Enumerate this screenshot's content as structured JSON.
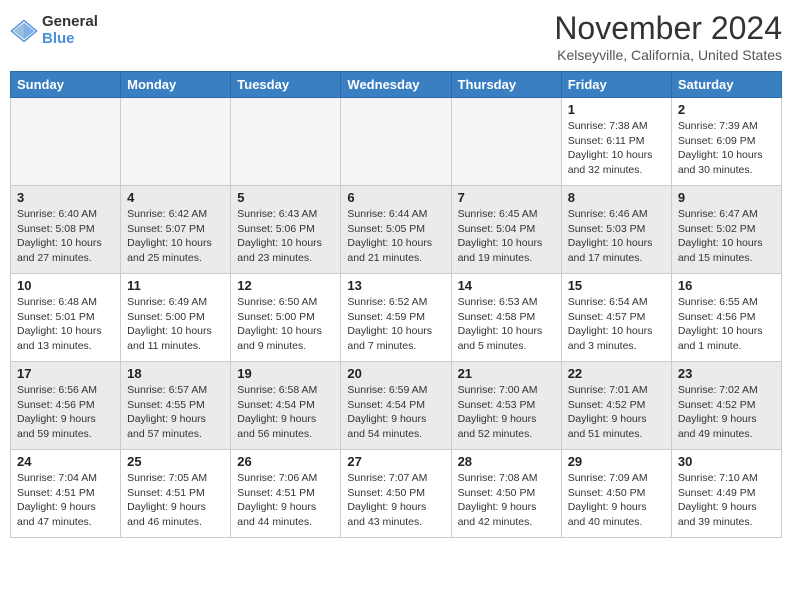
{
  "logo": {
    "general": "General",
    "blue": "Blue"
  },
  "title": "November 2024",
  "location": "Kelseyville, California, United States",
  "weekdays": [
    "Sunday",
    "Monday",
    "Tuesday",
    "Wednesday",
    "Thursday",
    "Friday",
    "Saturday"
  ],
  "weeks": [
    [
      {
        "day": "",
        "info": ""
      },
      {
        "day": "",
        "info": ""
      },
      {
        "day": "",
        "info": ""
      },
      {
        "day": "",
        "info": ""
      },
      {
        "day": "",
        "info": ""
      },
      {
        "day": "1",
        "info": "Sunrise: 7:38 AM\nSunset: 6:11 PM\nDaylight: 10 hours and 32 minutes."
      },
      {
        "day": "2",
        "info": "Sunrise: 7:39 AM\nSunset: 6:09 PM\nDaylight: 10 hours and 30 minutes."
      }
    ],
    [
      {
        "day": "3",
        "info": "Sunrise: 6:40 AM\nSunset: 5:08 PM\nDaylight: 10 hours and 27 minutes."
      },
      {
        "day": "4",
        "info": "Sunrise: 6:42 AM\nSunset: 5:07 PM\nDaylight: 10 hours and 25 minutes."
      },
      {
        "day": "5",
        "info": "Sunrise: 6:43 AM\nSunset: 5:06 PM\nDaylight: 10 hours and 23 minutes."
      },
      {
        "day": "6",
        "info": "Sunrise: 6:44 AM\nSunset: 5:05 PM\nDaylight: 10 hours and 21 minutes."
      },
      {
        "day": "7",
        "info": "Sunrise: 6:45 AM\nSunset: 5:04 PM\nDaylight: 10 hours and 19 minutes."
      },
      {
        "day": "8",
        "info": "Sunrise: 6:46 AM\nSunset: 5:03 PM\nDaylight: 10 hours and 17 minutes."
      },
      {
        "day": "9",
        "info": "Sunrise: 6:47 AM\nSunset: 5:02 PM\nDaylight: 10 hours and 15 minutes."
      }
    ],
    [
      {
        "day": "10",
        "info": "Sunrise: 6:48 AM\nSunset: 5:01 PM\nDaylight: 10 hours and 13 minutes."
      },
      {
        "day": "11",
        "info": "Sunrise: 6:49 AM\nSunset: 5:00 PM\nDaylight: 10 hours and 11 minutes."
      },
      {
        "day": "12",
        "info": "Sunrise: 6:50 AM\nSunset: 5:00 PM\nDaylight: 10 hours and 9 minutes."
      },
      {
        "day": "13",
        "info": "Sunrise: 6:52 AM\nSunset: 4:59 PM\nDaylight: 10 hours and 7 minutes."
      },
      {
        "day": "14",
        "info": "Sunrise: 6:53 AM\nSunset: 4:58 PM\nDaylight: 10 hours and 5 minutes."
      },
      {
        "day": "15",
        "info": "Sunrise: 6:54 AM\nSunset: 4:57 PM\nDaylight: 10 hours and 3 minutes."
      },
      {
        "day": "16",
        "info": "Sunrise: 6:55 AM\nSunset: 4:56 PM\nDaylight: 10 hours and 1 minute."
      }
    ],
    [
      {
        "day": "17",
        "info": "Sunrise: 6:56 AM\nSunset: 4:56 PM\nDaylight: 9 hours and 59 minutes."
      },
      {
        "day": "18",
        "info": "Sunrise: 6:57 AM\nSunset: 4:55 PM\nDaylight: 9 hours and 57 minutes."
      },
      {
        "day": "19",
        "info": "Sunrise: 6:58 AM\nSunset: 4:54 PM\nDaylight: 9 hours and 56 minutes."
      },
      {
        "day": "20",
        "info": "Sunrise: 6:59 AM\nSunset: 4:54 PM\nDaylight: 9 hours and 54 minutes."
      },
      {
        "day": "21",
        "info": "Sunrise: 7:00 AM\nSunset: 4:53 PM\nDaylight: 9 hours and 52 minutes."
      },
      {
        "day": "22",
        "info": "Sunrise: 7:01 AM\nSunset: 4:52 PM\nDaylight: 9 hours and 51 minutes."
      },
      {
        "day": "23",
        "info": "Sunrise: 7:02 AM\nSunset: 4:52 PM\nDaylight: 9 hours and 49 minutes."
      }
    ],
    [
      {
        "day": "24",
        "info": "Sunrise: 7:04 AM\nSunset: 4:51 PM\nDaylight: 9 hours and 47 minutes."
      },
      {
        "day": "25",
        "info": "Sunrise: 7:05 AM\nSunset: 4:51 PM\nDaylight: 9 hours and 46 minutes."
      },
      {
        "day": "26",
        "info": "Sunrise: 7:06 AM\nSunset: 4:51 PM\nDaylight: 9 hours and 44 minutes."
      },
      {
        "day": "27",
        "info": "Sunrise: 7:07 AM\nSunset: 4:50 PM\nDaylight: 9 hours and 43 minutes."
      },
      {
        "day": "28",
        "info": "Sunrise: 7:08 AM\nSunset: 4:50 PM\nDaylight: 9 hours and 42 minutes."
      },
      {
        "day": "29",
        "info": "Sunrise: 7:09 AM\nSunset: 4:50 PM\nDaylight: 9 hours and 40 minutes."
      },
      {
        "day": "30",
        "info": "Sunrise: 7:10 AM\nSunset: 4:49 PM\nDaylight: 9 hours and 39 minutes."
      }
    ]
  ]
}
